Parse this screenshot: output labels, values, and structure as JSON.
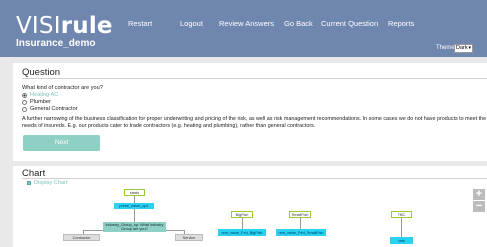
{
  "header": {
    "logo_visi": "VISI",
    "logo_rule": "rule",
    "app_name": "Insurance_demo",
    "nav": [
      "Restart",
      "Logout",
      "Review Answers",
      "Go Back",
      "Current Question",
      "Reports"
    ],
    "theme_label": "Theme",
    "theme_value": "Dark"
  },
  "question": {
    "title": "Question",
    "prompt": "What kind of contractor are you?",
    "options": [
      {
        "label": "Heating AC",
        "selected": true
      },
      {
        "label": "Plumber",
        "selected": false
      },
      {
        "label": "General Contractor",
        "selected": false
      }
    ],
    "description": "A further narrowing of the business classification for proper underwriting and pricing of the risk, as well as risk management recommendations. In some cases we do not have products to meet the needs of insureds. E.g. our products cater to trade contractors (e.g. heating and plumbing), rather than general contractors.",
    "next_label": "Next"
  },
  "chart": {
    "title": "Chart",
    "display_label": "Display Chart",
    "nodes": {
      "start": "starts",
      "prime": "prime_value_op1",
      "industry": "Industry_Group_op: What Industry Group are you?",
      "contractor": "Contractor",
      "service": "Service",
      "bigfish": "BigFish",
      "bigfish_val": "rein_value_Fed_BigFish",
      "smallfish": "SmallFish",
      "smallfish_val": "rein_value_Fed_SmallFish",
      "tbc": "TBC",
      "tbc_val": "rate"
    },
    "zoom_in": "+",
    "zoom_out": "−"
  }
}
